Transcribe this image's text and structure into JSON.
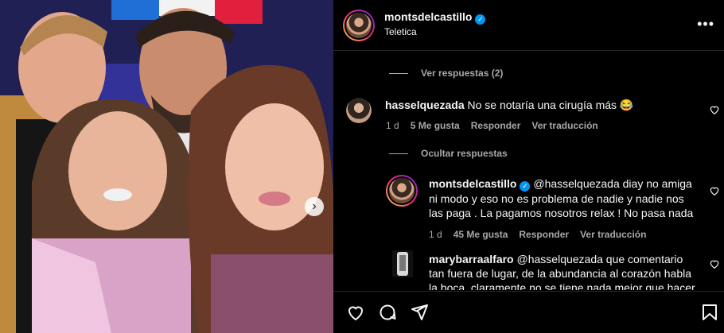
{
  "post": {
    "username": "montsdelcastillo",
    "location": "Teletica",
    "verified": true
  },
  "comments": {
    "view_replies": "Ver respuestas (2)",
    "hide_replies": "Ocultar respuestas",
    "items": [
      {
        "username": "hasselquezada",
        "text": "No se notaría una cirugía más 😂",
        "age": "1 d",
        "likes": "5 Me gusta",
        "reply": "Responder",
        "translate": "Ver traducción"
      },
      {
        "username": "montsdelcastillo",
        "verified": true,
        "text": "@hasselquezada diay no amiga ni modo y eso no es problema de nadie y nadie nos las paga . La pagamos nosotros relax ! No pasa nada",
        "age": "1 d",
        "likes": "45 Me gusta",
        "reply": "Responder",
        "translate": "Ver traducción"
      },
      {
        "username": "marybarraalfaro",
        "text": "@hasselquezada que comentario tan fuera de lugar, de la abundancia al corazón habla la boca, claramente no se tiene nada mejor que hacer"
      }
    ]
  },
  "icons": {
    "more": "more-options-icon",
    "like": "heart-icon",
    "comment": "comment-icon",
    "share": "paper-plane-icon",
    "save": "bookmark-icon",
    "next": "chevron-right-icon"
  },
  "colors": {
    "background": "#000000",
    "text": "#f5f5f5",
    "muted": "#a8a8a8",
    "verified": "#0095f6"
  }
}
